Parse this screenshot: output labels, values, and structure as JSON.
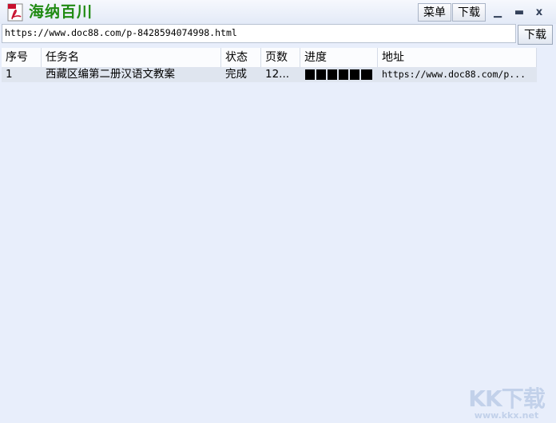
{
  "app": {
    "title": "海纳百川"
  },
  "toolbar": {
    "menu_label": "菜单",
    "download_label": "下载"
  },
  "window_controls": {
    "minimize": "▁",
    "maximize": "▬",
    "close": "x"
  },
  "url_input": {
    "value": "https://www.doc88.com/p-8428594074998.html"
  },
  "download_button": {
    "label": "下载"
  },
  "table": {
    "columns": [
      "序号",
      "任务名",
      "状态",
      "页数",
      "进度",
      "地址"
    ],
    "rows": [
      {
        "index": "1",
        "name": "西藏区编第二册汉语文教案",
        "status": "完成",
        "pages": "12...",
        "progress": 1.0,
        "url": "https://www.doc88.com/p..."
      }
    ]
  },
  "watermark": {
    "brand": "KK下载",
    "url": "www.kkx.net"
  },
  "colors": {
    "title": "#1f8a12",
    "background": "#e8eefb",
    "progress": "#000000"
  }
}
